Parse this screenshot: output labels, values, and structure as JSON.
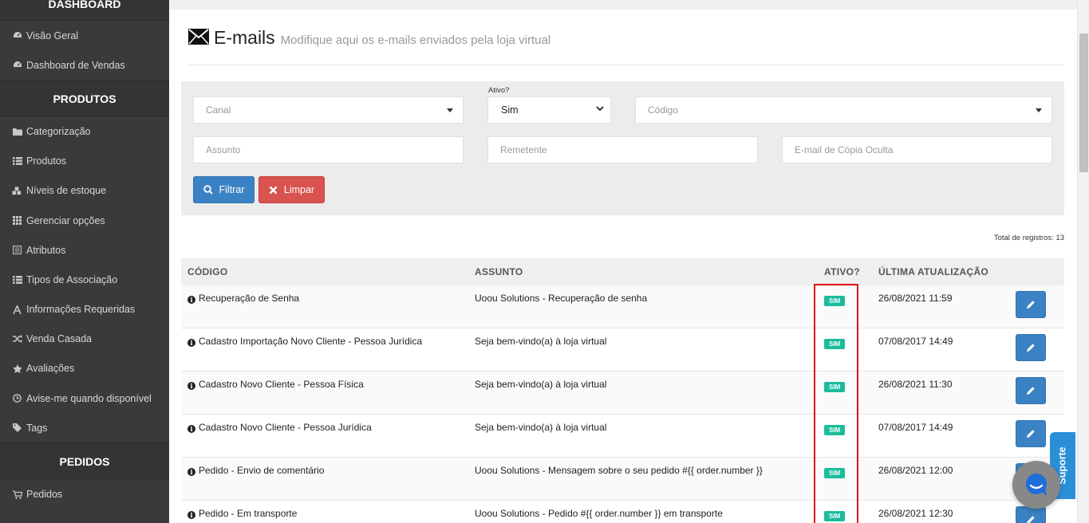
{
  "sidebar": {
    "section_dashboard": "DASHBOARD",
    "dashboard_items": [
      {
        "label": "Visão Geral",
        "icon": "tachometer-icon"
      },
      {
        "label": "Dashboard de Vendas",
        "icon": "tachometer-icon"
      }
    ],
    "section_produtos": "PRODUTOS",
    "produtos_items": [
      {
        "label": "Categorização",
        "icon": "folder-icon"
      },
      {
        "label": "Produtos",
        "icon": "list-icon"
      },
      {
        "label": "Níveis de estoque",
        "icon": "cubes-icon"
      },
      {
        "label": "Gerenciar opções",
        "icon": "grid-icon"
      },
      {
        "label": "Atributos",
        "icon": "list-alt-icon"
      },
      {
        "label": "Tipos de Associação",
        "icon": "list-icon"
      },
      {
        "label": "Informações Requeridas",
        "icon": "font-icon"
      },
      {
        "label": "Venda Casada",
        "icon": "random-icon"
      },
      {
        "label": "Avaliações",
        "icon": "star-icon"
      },
      {
        "label": "Avise-me quando disponível",
        "icon": "clock-icon"
      },
      {
        "label": "Tags",
        "icon": "tag-icon"
      }
    ],
    "section_pedidos": "PEDIDOS",
    "pedidos_items": [
      {
        "label": "Pedidos",
        "icon": "cart-icon"
      }
    ]
  },
  "header": {
    "title": "E-mails",
    "subtitle": "Modifique aqui os e-mails enviados pela loja virtual"
  },
  "filters": {
    "canal_placeholder": "Canal",
    "ativo_label": "Ativo?",
    "ativo_value": "Sim",
    "codigo_placeholder": "Código",
    "assunto_placeholder": "Assunto",
    "remetente_placeholder": "Remetente",
    "bcc_placeholder": "E-mail de Cópia Oculta",
    "filter_button": "Filtrar",
    "clear_button": "Limpar"
  },
  "total": "Total de registros: 13",
  "table": {
    "headers": [
      "CÓDIGO",
      "ASSUNTO",
      "ATIVO?",
      "ÚLTIMA ATUALIZAÇÃO"
    ],
    "rows": [
      {
        "codigo": "Recuperação de Senha",
        "assunto": "Uoou Solutions - Recuperação de senha",
        "ativo": "SIM",
        "data": "26/08/2021 11:59"
      },
      {
        "codigo": "Cadastro Importação Novo Cliente - Pessoa Jurídica",
        "assunto": "Seja bem-vindo(a) à loja virtual",
        "ativo": "SIM",
        "data": "07/08/2017 14:49"
      },
      {
        "codigo": "Cadastro Novo Cliente - Pessoa Física",
        "assunto": "Seja bem-vindo(a) à loja virtual",
        "ativo": "SIM",
        "data": "26/08/2021 11:30"
      },
      {
        "codigo": "Cadastro Novo Cliente - Pessoa Jurídica",
        "assunto": "Seja bem-vindo(a) à loja virtual",
        "ativo": "SIM",
        "data": "07/08/2017 14:49"
      },
      {
        "codigo": "Pedido - Envio de comentário",
        "assunto": "Uoou Solutions - Mensagem sobre o seu pedido #{{ order.number }}",
        "ativo": "SIM",
        "data": "26/08/2021 12:00"
      },
      {
        "codigo": "Pedido - Em transporte",
        "assunto": "Uoou Solutions - Pedido #{{ order.number }} em transporte",
        "ativo": "SIM",
        "data": "26/08/2021 12:30"
      }
    ]
  },
  "support": {
    "label": "Suporte"
  },
  "colors": {
    "sidebar_bg": "#3a3a3a",
    "primary": "#3b82c4",
    "danger": "#d9534f",
    "badge": "#1abc9c",
    "highlight": "#e01010"
  }
}
